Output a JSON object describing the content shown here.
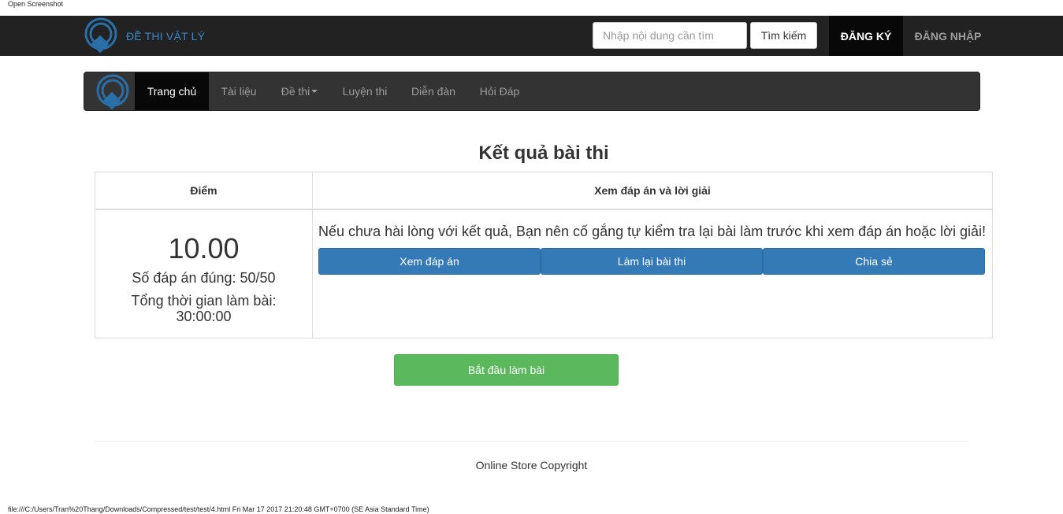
{
  "print": {
    "header": "Open Screenshot",
    "footer": "file:///C:/Users/Tran%20Thang/Downloads/Compressed/test/test/4.html Fri Mar 17 2017 21:20:48 GMT+0700 (SE Asia Standard Time)"
  },
  "topbar": {
    "brand": "ĐỀ THI VẬT LÝ",
    "search_placeholder": "Nhập nội dung cần tìm",
    "search_button": "Tìm kiếm",
    "register": "ĐĂNG KÝ",
    "login": "ĐĂNG NHẬP"
  },
  "nav": {
    "items": [
      {
        "label": "Trang chủ",
        "active": true
      },
      {
        "label": "Tài liệu"
      },
      {
        "label": "Đề thi",
        "dropdown": true
      },
      {
        "label": "Luyện thi"
      },
      {
        "label": "Diễn đàn"
      },
      {
        "label": "Hỏi Đáp"
      }
    ]
  },
  "result": {
    "title": "Kết quả bài thi",
    "col_score": "Điểm",
    "col_answers": "Xem đáp án và lời giải",
    "score": "10.00",
    "correct": "Số đáp án đúng: 50/50",
    "time_label": "Tổng thời gian làm bài:",
    "time_value": "30:00:00",
    "advice": "Nếu chưa hài lòng với kết quả, Bạn nên cố gắng tự kiểm tra lại bài làm trước khi xem đáp án hoặc lời giải!",
    "buttons": [
      "Xem đáp án",
      "Làm lại bài thi",
      "Chia sẻ"
    ]
  },
  "start_button": "Bắt đầu làm bài",
  "footer": {
    "copyright": "Online Store Copyright"
  },
  "colors": {
    "topbar_bg": "#222222",
    "brand": "#3a86c8",
    "primary": "#337ab7",
    "success": "#5cb85c"
  },
  "icons": {
    "logo": "diamond-circle-logo-icon",
    "dropdown": "caret-down-icon"
  }
}
